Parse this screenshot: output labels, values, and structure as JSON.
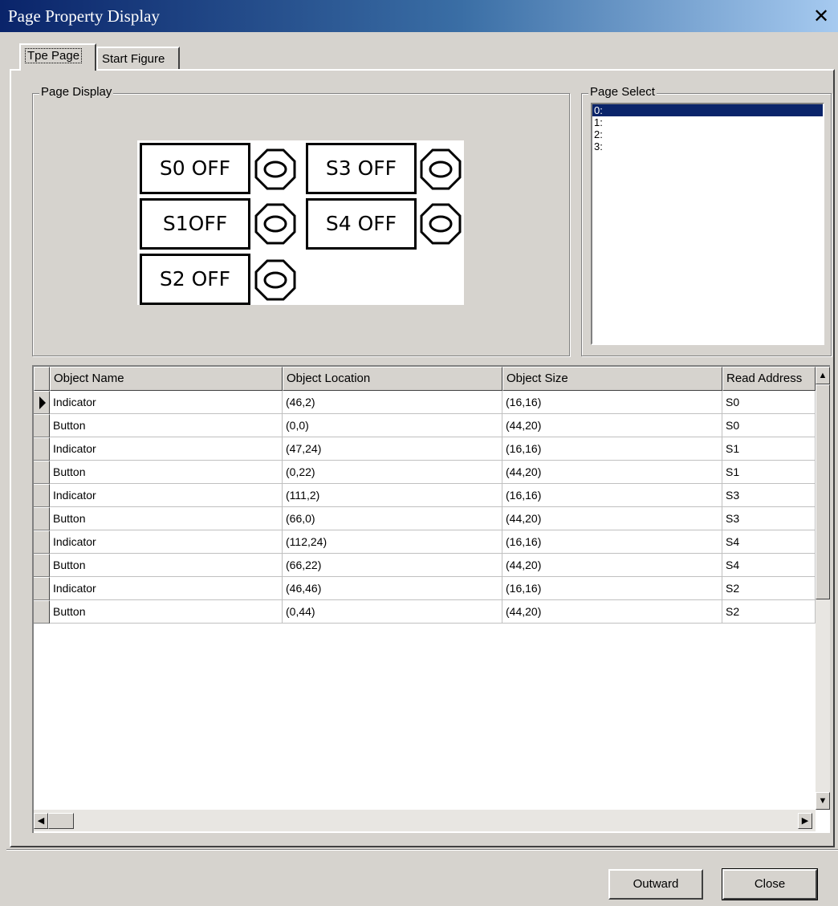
{
  "window": {
    "title": "Page Property Display",
    "close_glyph": "✕"
  },
  "tabs": [
    {
      "label": "Tpe Page",
      "active": true
    },
    {
      "label": "Start Figure",
      "active": false
    }
  ],
  "page_display": {
    "legend": "Page Display",
    "buttons": [
      {
        "label": "S0 OFF"
      },
      {
        "label": "S3 OFF"
      },
      {
        "label": "S1OFF"
      },
      {
        "label": "S4 OFF"
      },
      {
        "label": "S2 OFF"
      }
    ]
  },
  "page_select": {
    "legend": "Page Select",
    "items": [
      "0:",
      "1:",
      "2:",
      "3:"
    ],
    "selected_index": 0
  },
  "table": {
    "columns": [
      "Object Name",
      "Object Location",
      "Object Size",
      "Read Address"
    ],
    "rows": [
      [
        "Indicator",
        "(46,2)",
        "(16,16)",
        "S0"
      ],
      [
        "Button",
        "(0,0)",
        "(44,20)",
        "S0"
      ],
      [
        "Indicator",
        "(47,24)",
        "(16,16)",
        "S1"
      ],
      [
        "Button",
        "(0,22)",
        "(44,20)",
        "S1"
      ],
      [
        "Indicator",
        "(111,2)",
        "(16,16)",
        "S3"
      ],
      [
        "Button",
        "(66,0)",
        "(44,20)",
        "S3"
      ],
      [
        "Indicator",
        "(112,24)",
        "(16,16)",
        "S4"
      ],
      [
        "Button",
        "(66,22)",
        "(44,20)",
        "S4"
      ],
      [
        "Indicator",
        "(46,46)",
        "(16,16)",
        "S2"
      ],
      [
        "Button",
        "(0,44)",
        "(44,20)",
        "S2"
      ]
    ],
    "current_row": 0
  },
  "footer": {
    "outward_label": "Outward",
    "close_label": "Close"
  }
}
